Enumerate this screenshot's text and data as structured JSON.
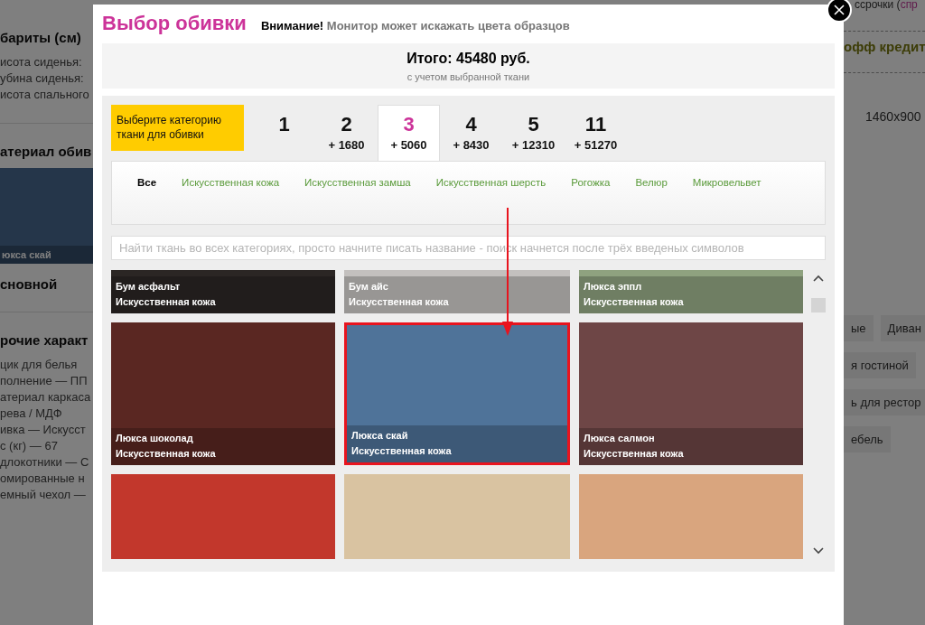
{
  "background": {
    "left_items": [
      {
        "kind": "heading",
        "text": "бариты (см)"
      },
      {
        "kind": "line",
        "text": "исота сиденья:"
      },
      {
        "kind": "line",
        "text": "убина сиденья:"
      },
      {
        "kind": "line",
        "text": "исота спального"
      },
      {
        "kind": "heading",
        "text": "атериал обив",
        "rule": true
      },
      {
        "kind": "swatch",
        "text": "юкса скай"
      },
      {
        "kind": "heading",
        "text": "сновной"
      },
      {
        "kind": "heading",
        "text": "рочие характ",
        "rule": true
      },
      {
        "kind": "line",
        "text": "цик для белья"
      },
      {
        "kind": "line",
        "text": "полнение — ПП"
      },
      {
        "kind": "line",
        "text": "атериал каркаса"
      },
      {
        "kind": "line",
        "text": "рева / МДФ"
      },
      {
        "kind": "line",
        "text": "ивка — Искусст"
      },
      {
        "kind": "line",
        "text": "с (кг) — 67"
      },
      {
        "kind": "line",
        "text": "длокотники — С"
      },
      {
        "kind": "line",
        "text": "омированные н"
      },
      {
        "kind": "line",
        "text": "емный чехол —"
      }
    ],
    "right_items": [
      {
        "kind": "link_line",
        "text": "ссрочки (",
        "link": "спр"
      },
      {
        "kind": "heading",
        "text": "офф кредит"
      },
      {
        "kind": "value",
        "text": "1460x900"
      },
      {
        "kind": "tags",
        "tags": [
          "ые",
          "Диван"
        ]
      },
      {
        "kind": "tags",
        "tags": [
          "я гостиной"
        ]
      },
      {
        "kind": "tags",
        "tags": [
          "ь для рестор"
        ]
      },
      {
        "kind": "tags",
        "tags": [
          "ебель"
        ]
      }
    ]
  },
  "dialog": {
    "title": "Выбор обивки",
    "warning_label": "Внимание!",
    "warning": "Монитор может искажать цвета образцов",
    "total": "Итого: 45480 руб.",
    "total_note": "с учетом выбранной ткани",
    "category_prompt": "Выберите категорию ткани для обивки",
    "categories": [
      {
        "number": "1",
        "selected": false
      },
      {
        "number": "2",
        "price": "+ 1680",
        "selected": false
      },
      {
        "number": "3",
        "price": "+ 5060",
        "selected": true
      },
      {
        "number": "4",
        "price": "+ 8430",
        "selected": false
      },
      {
        "number": "5",
        "price": "+ 12310",
        "selected": false
      },
      {
        "number": "11",
        "price": "+ 51270",
        "selected": false
      }
    ],
    "fabric_types": [
      {
        "label": "Все",
        "selected": true
      },
      {
        "label": "Искусственная кожа",
        "selected": false
      },
      {
        "label": "Искусственная замша",
        "selected": false
      },
      {
        "label": "Искусственная шерсть",
        "selected": false
      },
      {
        "label": "Рогожка",
        "selected": false
      },
      {
        "label": "Велюр",
        "selected": false
      },
      {
        "label": "Микровельвет",
        "selected": false
      }
    ],
    "search": {
      "placeholder": "Найти ткань во всех категориях, просто начните писать название - поиск начнется после трёх введеных символов"
    },
    "swatches": [
      {
        "name": "Бум асфальт",
        "category": "Искусственная кожа",
        "color": "#2b2624",
        "selected": false
      },
      {
        "name": "Бум айс",
        "category": "Искусственная кожа",
        "color": "#c3c0be",
        "selected": false
      },
      {
        "name": "Люкса эппл",
        "category": "Искусственная кожа",
        "color": "#8fa27f",
        "selected": false
      },
      {
        "name": "Люкса шоколад",
        "category": "Искусственная кожа",
        "color": "#5a2722",
        "selected": false
      },
      {
        "name": "Люкса скай",
        "category": "Искусственная кожа",
        "color": "#4f7399",
        "selected": true
      },
      {
        "name": "Люкса салмон",
        "category": "Искусственная кожа",
        "color": "#6e4646",
        "selected": false
      },
      {
        "color": "#c2372c",
        "selected": false
      },
      {
        "color": "#d9c3a1",
        "selected": false
      },
      {
        "color": "#d9a57e",
        "selected": false
      }
    ]
  }
}
